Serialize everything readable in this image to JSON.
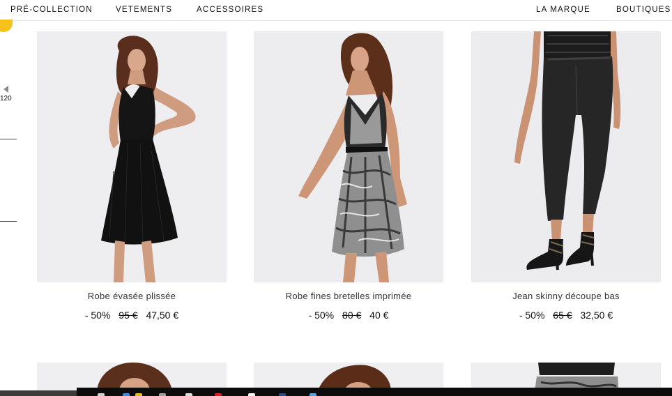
{
  "nav": {
    "left": [
      "PRÉ-COLLECTION",
      "VETEMENTS",
      "ACCESSOIRES"
    ],
    "right": [
      "LA MARQUE",
      "BOUTIQUES"
    ]
  },
  "sidebar": {
    "count": "120"
  },
  "products": [
    {
      "name": "Robe évasée plissée",
      "discount": "- 50%",
      "old_price": "95 €",
      "price": "47,50 €"
    },
    {
      "name": "Robe fines bretelles imprimée",
      "discount": "- 50%",
      "old_price": "80 €",
      "price": "40 €"
    },
    {
      "name": "Jean skinny découpe bas",
      "discount": "- 50%",
      "old_price": "65 €",
      "price": "32,50 €"
    }
  ],
  "colors": {
    "accent_badge": "#f6c21c",
    "text": "#111111",
    "image_bg": "#eeeef0"
  },
  "taskbar_icons": [
    "search-icon",
    "browser-icon",
    "folder-icon",
    "app-icon",
    "app-icon",
    "app-icon",
    "app-icon",
    "browser-icon"
  ]
}
